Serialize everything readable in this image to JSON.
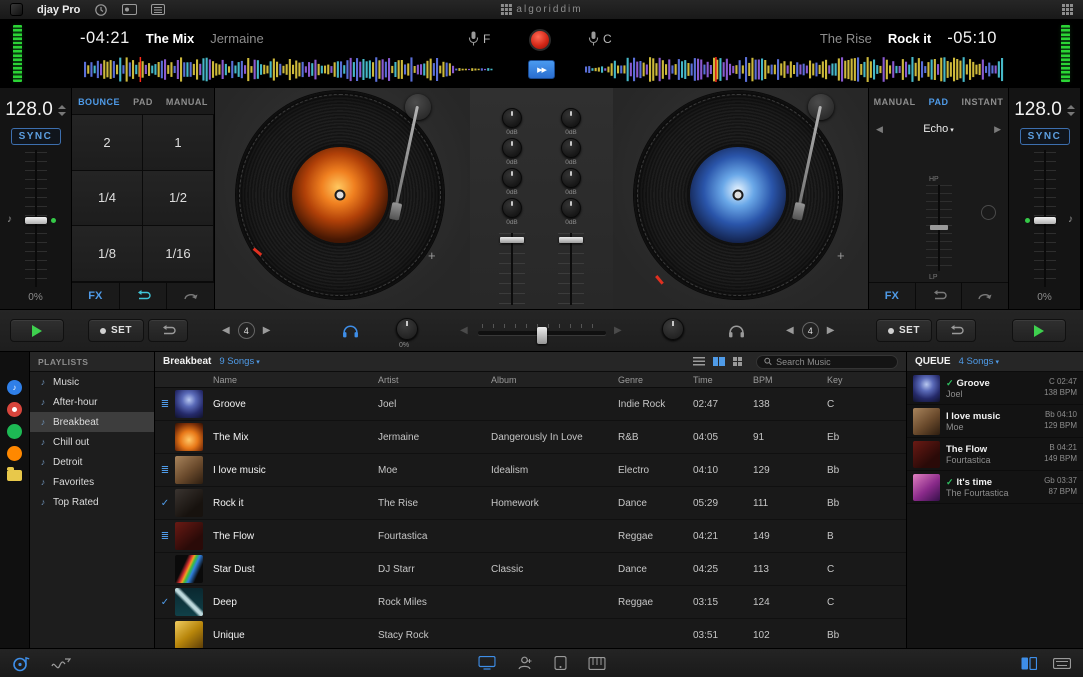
{
  "menubar": {
    "app_name": "djay Pro",
    "brand": "algoriddim"
  },
  "deck_a": {
    "time": "-04:21",
    "title": "The Mix",
    "artist": "Jermaine",
    "mic_label": "F",
    "bpm": "128.0",
    "sync": "SYNC",
    "pitch": "0%",
    "tabs": [
      "BOUNCE",
      "PAD",
      "MANUAL"
    ],
    "active_tab": "BOUNCE",
    "pads": [
      "2",
      "1",
      "1/4",
      "1/2",
      "1/8",
      "1/16"
    ],
    "fx": "FX"
  },
  "deck_b": {
    "time": "-05:10",
    "title": "Rock it",
    "artist": "The Rise",
    "mic_label": "C",
    "bpm": "128.0",
    "sync": "SYNC",
    "pitch": "0%",
    "tabs": [
      "MANUAL",
      "PAD",
      "INSTANT"
    ],
    "active_tab": "PAD",
    "fx_selected": "Echo",
    "fx": "FX",
    "filter_labels": {
      "hp": "HP",
      "lp": "LP"
    }
  },
  "mixer": {
    "knob_label": "0dB"
  },
  "transport": {
    "set": "SET",
    "beat_jump": "4",
    "cue_level": "0%"
  },
  "library": {
    "sidebar_header": "PLAYLISTS",
    "playlists": [
      "Music",
      "After-hour",
      "Breakbeat",
      "Chill out",
      "Detroit",
      "Favorites",
      "Top Rated"
    ],
    "selected_playlist": "Breakbeat",
    "songs_count": "9 Songs",
    "search_placeholder": "Search Music",
    "columns": [
      "Name",
      "Artist",
      "Album",
      "Genre",
      "Time",
      "BPM",
      "Key"
    ],
    "rows": [
      {
        "status": "queued",
        "art": "groove",
        "name": "Groove",
        "artist": "Joel",
        "album": "",
        "genre": "Indie Rock",
        "time": "02:47",
        "bpm": "138",
        "key": "C"
      },
      {
        "status": "",
        "art": "themix",
        "name": "The Mix",
        "artist": "Jermaine",
        "album": "Dangerously In Love",
        "genre": "R&B",
        "time": "04:05",
        "bpm": "91",
        "key": "Eb"
      },
      {
        "status": "queued",
        "art": "ilovemusic",
        "name": "I love music",
        "artist": "Moe",
        "album": "Idealism",
        "genre": "Electro",
        "time": "04:10",
        "bpm": "129",
        "key": "Bb"
      },
      {
        "status": "played",
        "art": "rockit",
        "name": "Rock it",
        "artist": "The Rise",
        "album": "Homework",
        "genre": "Dance",
        "time": "05:29",
        "bpm": "111",
        "key": "Bb"
      },
      {
        "status": "queued",
        "art": "theflow",
        "name": "The Flow",
        "artist": "Fourtastica",
        "album": "",
        "genre": "Reggae",
        "time": "04:21",
        "bpm": "149",
        "key": "B"
      },
      {
        "status": "",
        "art": "stardust",
        "name": "Star Dust",
        "artist": "DJ Starr",
        "album": "Classic",
        "genre": "Dance",
        "time": "04:25",
        "bpm": "113",
        "key": "C"
      },
      {
        "status": "played",
        "art": "deep",
        "name": "Deep",
        "artist": "Rock Miles",
        "album": "",
        "genre": "Reggae",
        "time": "03:15",
        "bpm": "124",
        "key": "C"
      },
      {
        "status": "",
        "art": "unique",
        "name": "Unique",
        "artist": "Stacy Rock",
        "album": "",
        "genre": "",
        "time": "03:51",
        "bpm": "102",
        "key": "Bb"
      }
    ]
  },
  "queue": {
    "header": "QUEUE",
    "count": "4 Songs",
    "items": [
      {
        "title": "Groove",
        "artist": "Joel",
        "key_time": "C 02:47",
        "bpm": "138 BPM",
        "played": true,
        "art": "groove"
      },
      {
        "title": "I love music",
        "artist": "Moe",
        "key_time": "Bb 04:10",
        "bpm": "129 BPM",
        "played": false,
        "art": "ilovemusic"
      },
      {
        "title": "The Flow",
        "artist": "Fourtastica",
        "key_time": "B 04:21",
        "bpm": "149 BPM",
        "played": false,
        "art": "theflow"
      },
      {
        "title": "It's time",
        "artist": "The Fourtastica",
        "key_time": "Gb 03:37",
        "bpm": "87 BPM",
        "played": true,
        "art": "itstime"
      }
    ]
  },
  "icons": {
    "caret_down": "▾",
    "check": "✓",
    "queued": "≣",
    "note": "♪",
    "prev": "◀",
    "next": "▶"
  },
  "colors": {
    "accent_blue": "#4f9be8",
    "play_green": "#3ed04e",
    "check_green": "#2fbf60",
    "record_red": "#d42818",
    "vu_green": "#2bd435"
  }
}
